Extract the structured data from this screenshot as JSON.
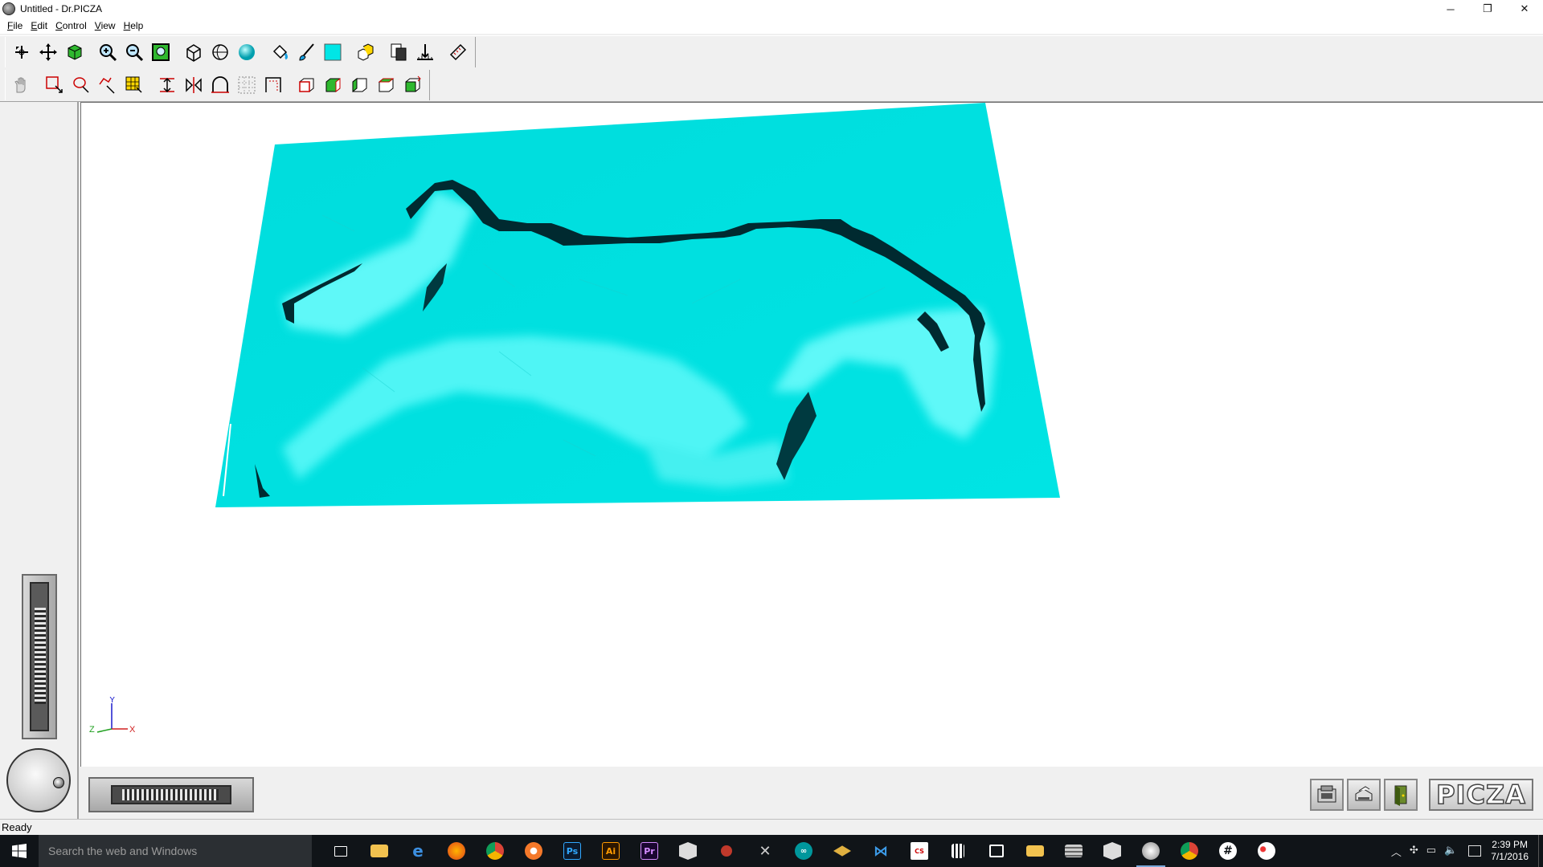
{
  "window": {
    "title": "Untitled - Dr.PICZA",
    "controls": {
      "minimize": "─",
      "restore": "❐",
      "close": "✕"
    }
  },
  "menu": [
    {
      "key": "F",
      "rest": "ile"
    },
    {
      "key": "E",
      "rest": "dit"
    },
    {
      "key": "C",
      "rest": "ontrol"
    },
    {
      "key": "V",
      "rest": "iew"
    },
    {
      "key": "H",
      "rest": "elp"
    }
  ],
  "toolbar1": [
    "select-rotate-icon",
    "move-icon",
    "cube-icon",
    "zoom-in-icon",
    "zoom-out-icon",
    "zoom-fit-icon",
    "wireframe-icon",
    "hidden-line-icon",
    "shaded-sphere-icon",
    "paint-bucket-icon",
    "brush-icon",
    "color-swatch-icon",
    "box-stack-icon",
    "copy-page-icon",
    "depth-icon",
    "ruler-icon"
  ],
  "toolbar2": [
    "hand-icon",
    "rect-select-icon",
    "lasso-select-icon",
    "magic-select-icon",
    "grid-select-icon",
    "mirror-vertical-icon",
    "mirror-horizontal-icon",
    "arch-icon",
    "grid-icon",
    "frame-icon",
    "box-front-icon",
    "box-side-icon",
    "box-back-icon",
    "box-top-icon",
    "box-rotate-icon"
  ],
  "colors": {
    "surface": "#00e0e0",
    "surface_light": "#33f3f3",
    "shadow": "#002a30",
    "taskbar": "#101418"
  },
  "axis": {
    "x": "X",
    "y": "Y",
    "z": "Z"
  },
  "logo_text": "PICZA",
  "status": "Ready",
  "taskbar": {
    "search_placeholder": "Search the web and Windows",
    "time": "2:39 PM",
    "date": "7/1/2016"
  }
}
